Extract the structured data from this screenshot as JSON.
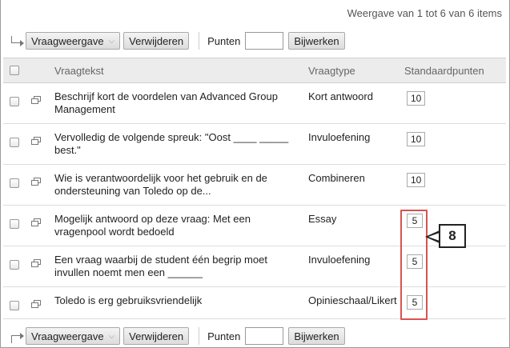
{
  "summary": "Weergave van 1 tot 6 van 6 items",
  "toolbar": {
    "view_label": "Vraagweergave",
    "delete_label": "Verwijderen",
    "points_label": "Punten",
    "points_value": "",
    "update_label": "Bijwerken"
  },
  "columns": {
    "text": "Vraagtekst",
    "type": "Vraagtype",
    "points": "Standaardpunten"
  },
  "rows": [
    {
      "text": " Beschrijf kort de voordelen van Advanced Group Management",
      "type": "Kort antwoord",
      "points": "10"
    },
    {
      "text": "Vervolledig de volgende spreuk: \"Oost ____ _____ best.\"",
      "type": "Invuloefening",
      "points": "10"
    },
    {
      "text": "Wie is verantwoordelijk voor het gebruik en de ondersteuning van Toledo op de...",
      "type": "Combineren",
      "points": "10"
    },
    {
      "text": "Mogelijk antwoord op deze vraag: Met een vragenpool wordt bedoeld",
      "type": "Essay",
      "points": "5"
    },
    {
      "text": "Een vraag waarbij de student één begrip moet invullen noemt men een ______",
      "type": "Invuloefening",
      "points": "5"
    },
    {
      "text": "Toledo is erg gebruiksvriendelijk",
      "type": "Opinieschaal/Likert",
      "points": "5"
    }
  ],
  "callout": "8",
  "colors": {
    "highlight": "#d9534f",
    "header_bg": "#ececec"
  }
}
